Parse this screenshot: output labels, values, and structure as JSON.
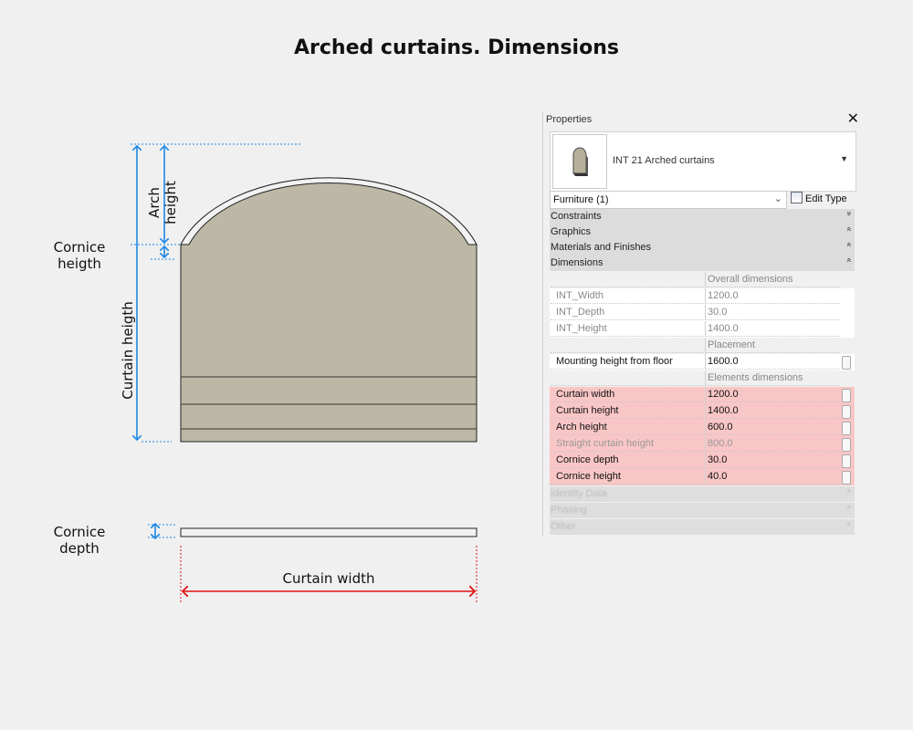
{
  "title": "Arched curtains. Dimensions",
  "labels": {
    "arch_height": [
      "Arch",
      "height"
    ],
    "cornice_height": [
      "Cornice",
      "heigth"
    ],
    "curtain_height": "Curtain heigth",
    "cornice_depth": [
      "Cornice",
      "depth"
    ],
    "curtain_width": "Curtain width"
  },
  "colors": {
    "background": "#f0f0f0",
    "curtain_fill": "#bdb8a5",
    "cornice_fill": "#f2f2f2",
    "dim_blue": "#1e88e5",
    "dim_red": "#e01010",
    "highlight_row": "#f9c6c6"
  },
  "properties": {
    "title": "Properties",
    "close_icon": "close-icon",
    "type_name": "INT 21 Arched curtains",
    "category_select": "Furniture (1)",
    "edit_type_label": "Edit Type",
    "groups": [
      {
        "label": "Constraints",
        "icon": "expand-icon",
        "glyph": "»"
      },
      {
        "label": "Graphics",
        "icon": "collapse-icon",
        "glyph": "«"
      },
      {
        "label": "Materials and Finishes",
        "icon": "collapse-icon",
        "glyph": "«"
      },
      {
        "label": "Dimensions",
        "icon": "collapse-icon",
        "glyph": "«"
      }
    ],
    "rows": [
      {
        "name": "",
        "value": "Overall dimensions",
        "kind": "hdr"
      },
      {
        "name": "INT_Width",
        "value": "1200.0",
        "kind": "dim"
      },
      {
        "name": "INT_Depth",
        "value": "30.0",
        "kind": "dim"
      },
      {
        "name": "INT_Height",
        "value": "1400.0",
        "kind": "dim"
      },
      {
        "name": "",
        "value": "Placement",
        "kind": "hdr"
      },
      {
        "name": "Mounting height from floor",
        "value": "1600.0",
        "kind": "plain"
      },
      {
        "name": "",
        "value": "Elements dimensions",
        "kind": "hdr"
      },
      {
        "name": "Curtain width",
        "value": "1200.0",
        "kind": "hl"
      },
      {
        "name": "Curtain height",
        "value": "1400.0",
        "kind": "hl"
      },
      {
        "name": "Arch height",
        "value": "600.0",
        "kind": "hl"
      },
      {
        "name": "Straight curtain height",
        "value": "800.0",
        "kind": "hl dim"
      },
      {
        "name": "Cornice depth",
        "value": "30.0",
        "kind": "hl"
      },
      {
        "name": "Cornice height",
        "value": "40.0",
        "kind": "hl"
      }
    ],
    "faded_groups": [
      {
        "label": "Identity Data",
        "glyph": "«"
      },
      {
        "label": "Phasing",
        "glyph": "«"
      },
      {
        "label": "Other",
        "glyph": "«"
      }
    ]
  }
}
